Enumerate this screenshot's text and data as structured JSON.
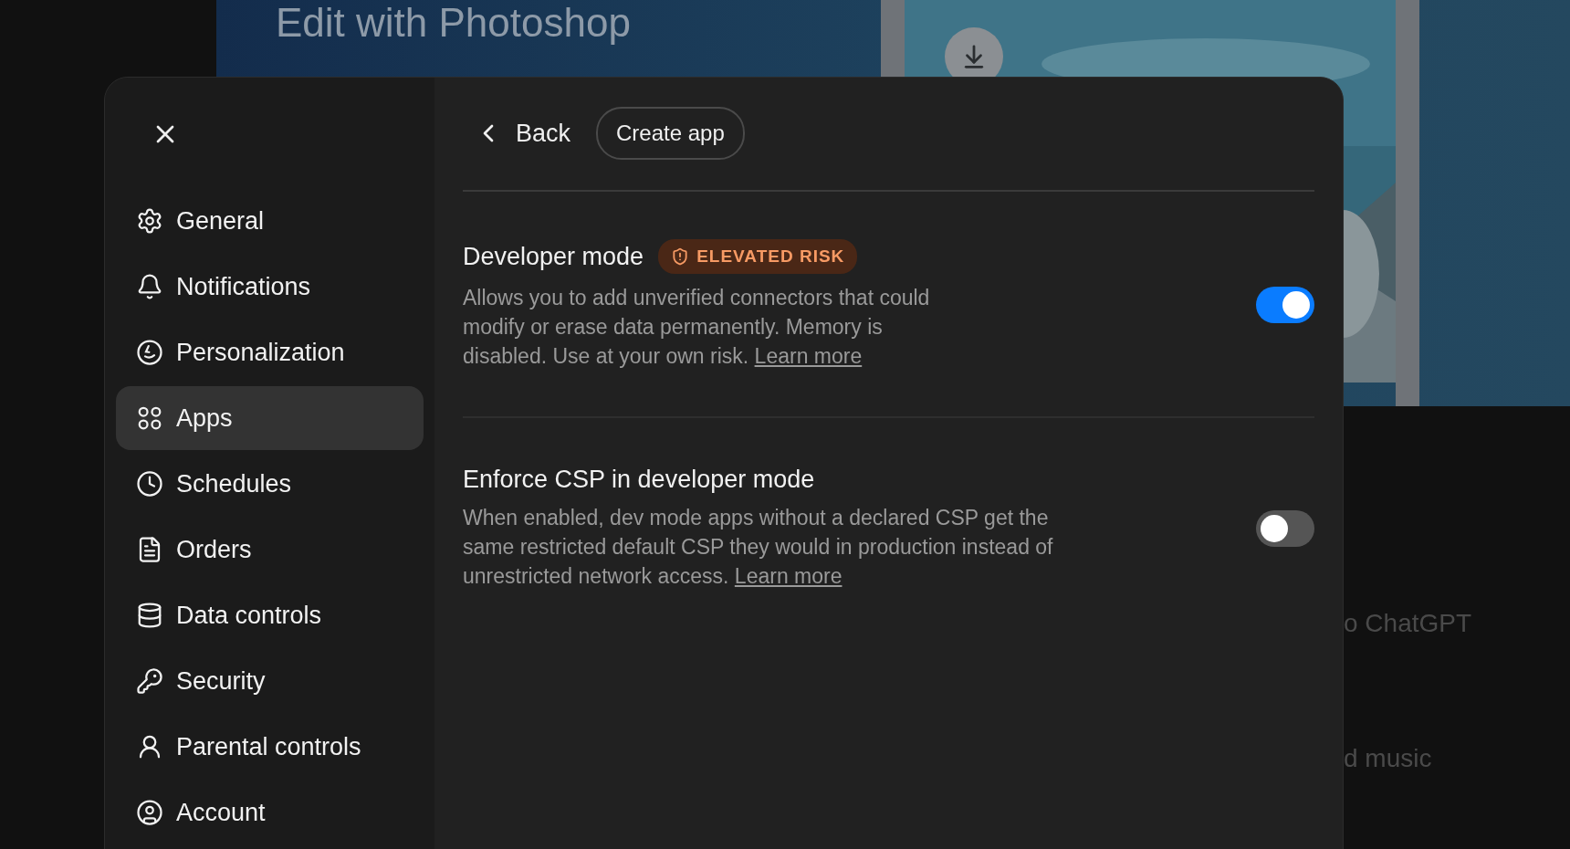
{
  "background": {
    "banner": {
      "title": "Edit with Photoshop"
    },
    "texts": [
      "o ChatGPT",
      "d music"
    ]
  },
  "dialog": {
    "sidebar": {
      "items": [
        {
          "label": "General",
          "selected": false
        },
        {
          "label": "Notifications",
          "selected": false
        },
        {
          "label": "Personalization",
          "selected": false
        },
        {
          "label": "Apps",
          "selected": true
        },
        {
          "label": "Schedules",
          "selected": false
        },
        {
          "label": "Orders",
          "selected": false
        },
        {
          "label": "Data controls",
          "selected": false
        },
        {
          "label": "Security",
          "selected": false
        },
        {
          "label": "Parental controls",
          "selected": false
        },
        {
          "label": "Account",
          "selected": false
        }
      ]
    },
    "header": {
      "back": "Back",
      "create_button": "Create app"
    },
    "settings": [
      {
        "title": "Developer mode",
        "badge": "ELEVATED RISK",
        "description": "Allows you to add unverified connectors that could modify or erase data permanently. Memory is disabled. Use at your own risk.",
        "link": "Learn more",
        "on": true
      },
      {
        "title": "Enforce CSP in developer mode",
        "description": "When enabled, dev mode apps without a declared CSP get the same restricted default CSP they would in production instead of unrestricted network access.",
        "link": "Learn more",
        "on": false
      }
    ]
  }
}
